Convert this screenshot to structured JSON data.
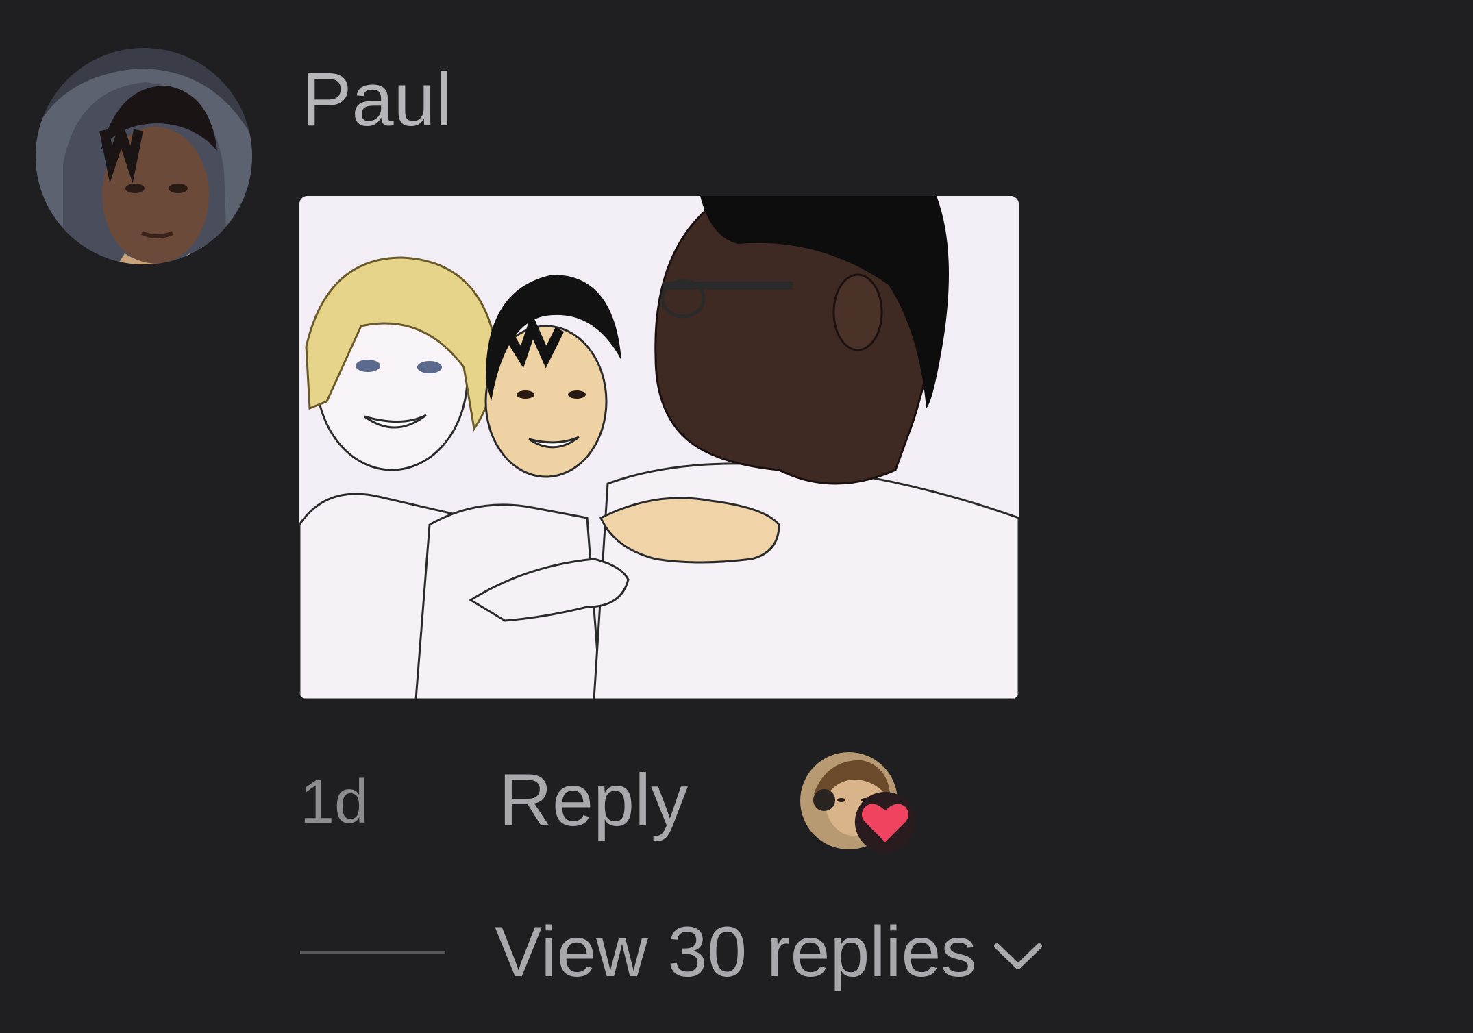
{
  "comment": {
    "author": "Paul",
    "avatar_icon": "user-avatar-photo",
    "attachment_icon": "cartoon-image",
    "timestamp": "1d",
    "reply_label": "Reply",
    "creator_liked": true,
    "heart_color": "#f0435f"
  },
  "replies": {
    "label": "View 30 replies",
    "icon": "chevron-down-icon"
  },
  "colors": {
    "background": "#1f1e21",
    "primary_text": "#b6b6ba",
    "secondary_text": "#8c8c91"
  }
}
